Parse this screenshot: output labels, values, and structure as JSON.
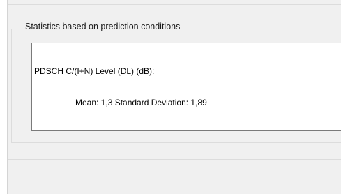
{
  "groupbox": {
    "title": "Statistics based on prediction conditions"
  },
  "statistics": {
    "line1": "PDSCH C/(I+N) Level (DL) (dB):",
    "line2": "Mean: 1,3 Standard Deviation: 1,89"
  }
}
